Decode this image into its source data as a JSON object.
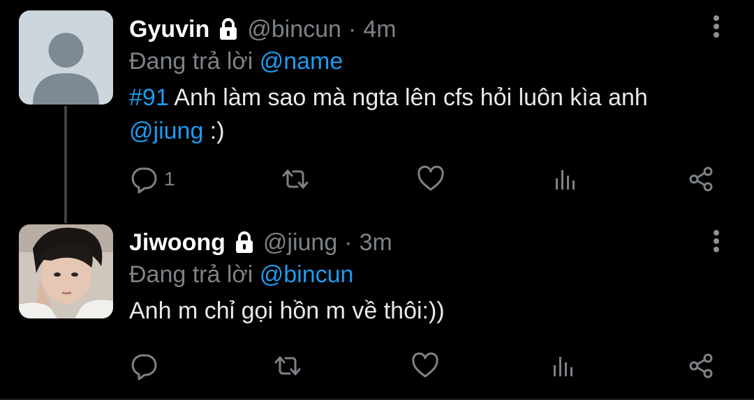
{
  "colors": {
    "background": "#000000",
    "text_primary": "#e7e9ea",
    "text_secondary": "#7d8287",
    "link": "#1d9bf0"
  },
  "tweets": [
    {
      "display_name": "Gyuvin",
      "protected_icon": "lock-icon",
      "handle": "@bincun",
      "separator": "·",
      "time": "4m",
      "reply_prefix": "Đang trả lời",
      "reply_to": "@name",
      "body": {
        "hashtag": "#91",
        "text": " Anh làm sao mà ngta lên cfs hỏi luôn kìa anh",
        "mention": "@jiung",
        "suffix": " :)"
      },
      "reply_count": "1",
      "avatar": "default-avatar-icon"
    },
    {
      "display_name": "Jiwoong",
      "protected_icon": "lock-icon",
      "handle": "@jiung",
      "separator": "·",
      "time": "3m",
      "reply_prefix": "Đang trả lời",
      "reply_to": "@bincun",
      "body": {
        "text": "Anh m chỉ gọi hồn m về thôi:))"
      },
      "reply_count": "",
      "avatar": "profile-photo"
    }
  ],
  "action_icons": [
    "reply-icon",
    "retweet-icon",
    "like-icon",
    "analytics-icon",
    "share-icon"
  ]
}
